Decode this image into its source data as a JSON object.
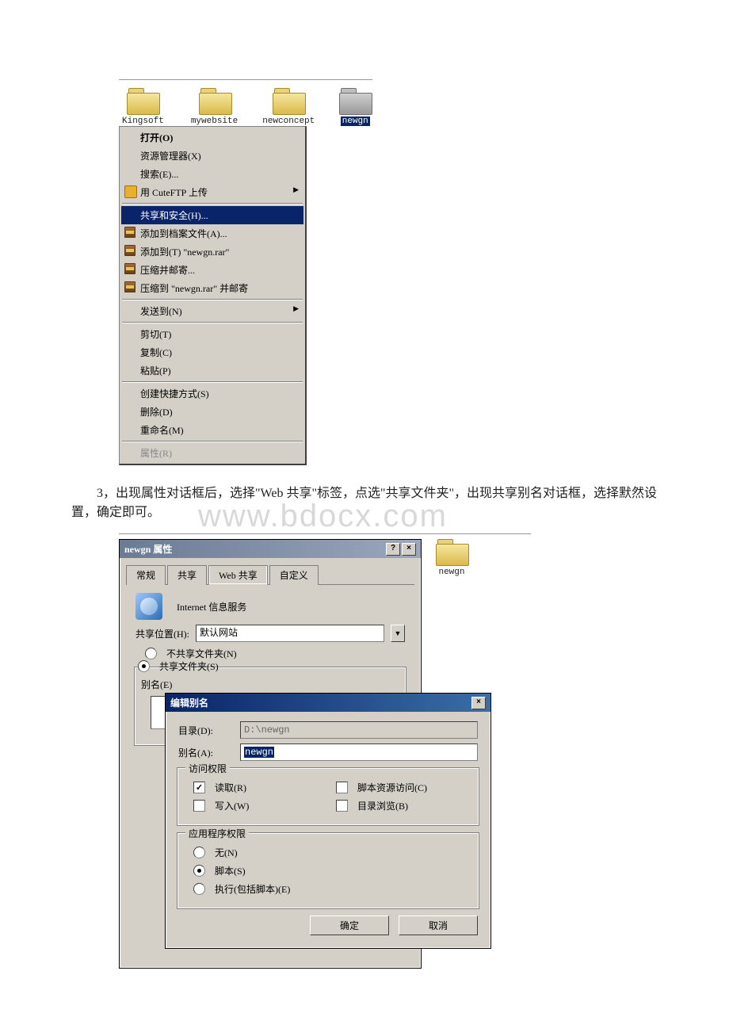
{
  "folders": [
    {
      "label": "Kingsoft"
    },
    {
      "label": "mywebsite"
    },
    {
      "label": "newconcept"
    },
    {
      "label": "newgn",
      "selected": true
    }
  ],
  "contextMenu": {
    "open": "打开(O)",
    "explorer": "资源管理器(X)",
    "search": "搜索(E)...",
    "cuteftp": "用 CuteFTP 上传",
    "share": "共享和安全(H)...",
    "addArchive": "添加到档案文件(A)...",
    "addTo": "添加到(T) \"newgn.rar\"",
    "compressMail": "压缩并邮寄...",
    "compressToMail": "压缩到 \"newgn.rar\" 并邮寄",
    "sendTo": "发送到(N)",
    "cut": "剪切(T)",
    "copy": "复制(C)",
    "paste": "粘贴(P)",
    "shortcut": "创建快捷方式(S)",
    "delete": "删除(D)",
    "rename": "重命名(M)",
    "properties": "属性(R)"
  },
  "bodyText": "3，出现属性对话框后，选择\"Web 共享\"标签，点选\"共享文件夹\"，出现共享别名对话框，选择默然设置，确定即可。",
  "watermark": "www.bdocx.com",
  "propDialog": {
    "title": "newgn 属性",
    "tabs": {
      "general": "常规",
      "share": "共享",
      "webshare": "Web 共享",
      "custom": "自定义"
    },
    "iisLabel": "Internet 信息服务",
    "shareLocLabel": "共享位置(H):",
    "shareLocValue": "默认网站",
    "noShare": "不共享文件夹(N)",
    "doShare": "共享文件夹(S)",
    "aliasLabel": "别名(E)"
  },
  "sideFolder": {
    "label": "newgn"
  },
  "aliasDialog": {
    "title": "编辑别名",
    "dirLabel": "目录(D):",
    "dirValue": "D:\\newgn",
    "aliasLabel": "别名(A):",
    "aliasValue": "newgn",
    "accessGroup": "访问权限",
    "read": "读取(R)",
    "write": "写入(W)",
    "script": "脚本资源访问(C)",
    "browse": "目录浏览(B)",
    "appGroup": "应用程序权限",
    "none": "无(N)",
    "scripts": "脚本(S)",
    "exec": "执行(包括脚本)(E)",
    "ok": "确定",
    "cancel": "取消"
  }
}
